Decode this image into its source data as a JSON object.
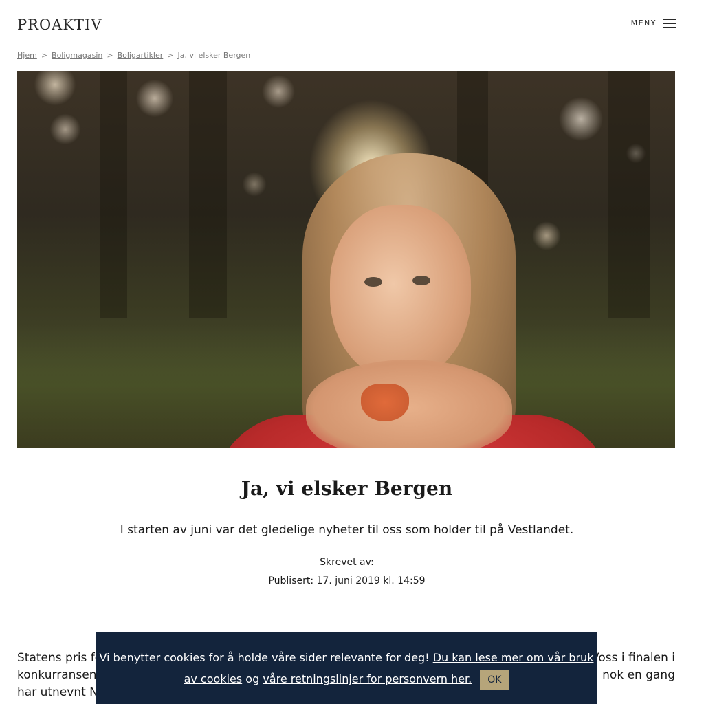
{
  "header": {
    "logo": "PROAKTIV",
    "menu_label": "MENY"
  },
  "breadcrumb": {
    "items": [
      "Hjem",
      "Boligmagasin",
      "Boligartikler",
      "Ja, vi elsker Bergen"
    ],
    "separator": ">"
  },
  "hero": {
    "icon": "photo-girl-heart-hands"
  },
  "article": {
    "title": "Ja, vi elsker Bergen",
    "lead": "I starten av juni var det gledelige nyheter til oss som holder til på Vestlandet.",
    "author_label": "Skrevet av:",
    "published": "Publisert: 17. juni 2019 kl. 14:59",
    "body_line1_start": "Statens pris fo",
    "body_line1_end": "Voss i finalen i",
    "body_line2_start": "konkurransen",
    "body_line2_end": "nok en gang",
    "body_line3_start": "har utnevnt N"
  },
  "cookie_banner": {
    "text_before": "Vi benytter cookies for å holde våre sider relevante for deg! ",
    "link_cookies": "Du kan lese mer om vår bruk av cookies",
    "text_middle": " og ",
    "link_privacy": "våre retningslinjer for personvern her.",
    "ok_label": "OK"
  },
  "colors": {
    "cookie_bg": "#13243c",
    "ok_button": "#b6a57a"
  }
}
